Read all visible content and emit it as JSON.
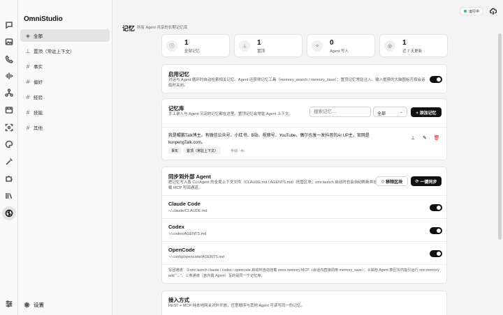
{
  "app": {
    "name": "OmniStudio"
  },
  "rail": [
    "chat-icon",
    "image-icon",
    "phone-icon",
    "waveform-icon",
    "nodes-icon",
    "film-icon",
    "scan-icon",
    "palette-icon",
    "wand-icon",
    "puzzle-icon",
    "library-icon",
    "brain-icon",
    "sliders-icon"
  ],
  "sidebar": {
    "items": [
      {
        "icon": "layers-icon",
        "label": "全部"
      },
      {
        "icon": "pin-icon",
        "label": "置顶（常驻上下文）"
      },
      {
        "icon": "hash-icon",
        "label": "事实"
      },
      {
        "icon": "hash-icon",
        "label": "偏好"
      },
      {
        "icon": "hash-icon",
        "label": "经验"
      },
      {
        "icon": "hash-icon",
        "label": "技能"
      },
      {
        "icon": "hash-icon",
        "label": "其他"
      }
    ],
    "settings_label": "设置"
  },
  "topbar": {
    "status": "运行中"
  },
  "page": {
    "title": "记忆",
    "subtitle": "所有 Agent 共享的长期记忆库"
  },
  "stats": [
    {
      "icon": "info-icon",
      "value": "1",
      "label": "全部记忆"
    },
    {
      "icon": "pin-icon",
      "value": "1",
      "label": "置顶"
    },
    {
      "icon": "sparkle-icon",
      "value": "0",
      "label": "Agent 写入"
    },
    {
      "icon": "globe-icon",
      "value": "1",
      "label": "近 7 天更新"
    }
  ],
  "enable_memory": {
    "title": "启用记忆",
    "desc": "对话与 Agent 循环时自动检索相关记忆。Agent 还获得记忆工具（memory_search / memory_save）；置顶记忆常驻注入。输入框旁的大脑图标可按会话临时关闭。",
    "enabled": true
  },
  "library": {
    "title": "记忆库",
    "desc": "手工录入与 Agent 沉淀的记忆都在这里。置顶记忆会常驻 Agent 上下文。",
    "search_placeholder": "搜索记忆…",
    "filter_value": "全部",
    "add_label": "+ 添加记忆",
    "entry": {
      "text": "我是鲲鹏Talk博主。有微信公众号、小红书、B站、视频号、YouTube，偶尔也发一发抖音的AI UP主，官网是kunpengTalk.com。",
      "tags": [
        "事实",
        "置顶（常驻上下文）"
      ],
      "meta": "手动 · 4s"
    }
  },
  "sync": {
    "title": "同步到外部 Agent",
    "desc": "把记忆写入各 CLI Agent 的全局上下文文件（CLAUDE.md / AGENTS.md）托管区块；omi launch 启动时也会自动刷新并挂载 MCP 写回通道。",
    "remove_label": "移除区块",
    "sync_label": "一键同步",
    "tools": [
      {
        "name": "Claude Code",
        "path": "~/.claude/CLAUDE.md",
        "enabled": true
      },
      {
        "name": "Codex",
        "path": "~/.codex/AGENTS.md",
        "enabled": true
      },
      {
        "name": "OpenCode",
        "path": "~/.config/opencode/AGENTS.md",
        "enabled": true
      }
    ],
    "note": "写回通道：①omi launch claude / codex / opencode 启动时自动挂载 omni-memory MCP（会话内直接调用 memory_save）；②其他 Agent 按区块内指引运行 omi memory add \"…\"。三条通道（含内置 Agent）写的是同一个记忆库。"
  },
  "access": {
    "title": "接入方式",
    "desc": "REST + MCP 纯本地网关对外开放，任意顺序与其他 Agent 可读写同一份记忆。"
  }
}
